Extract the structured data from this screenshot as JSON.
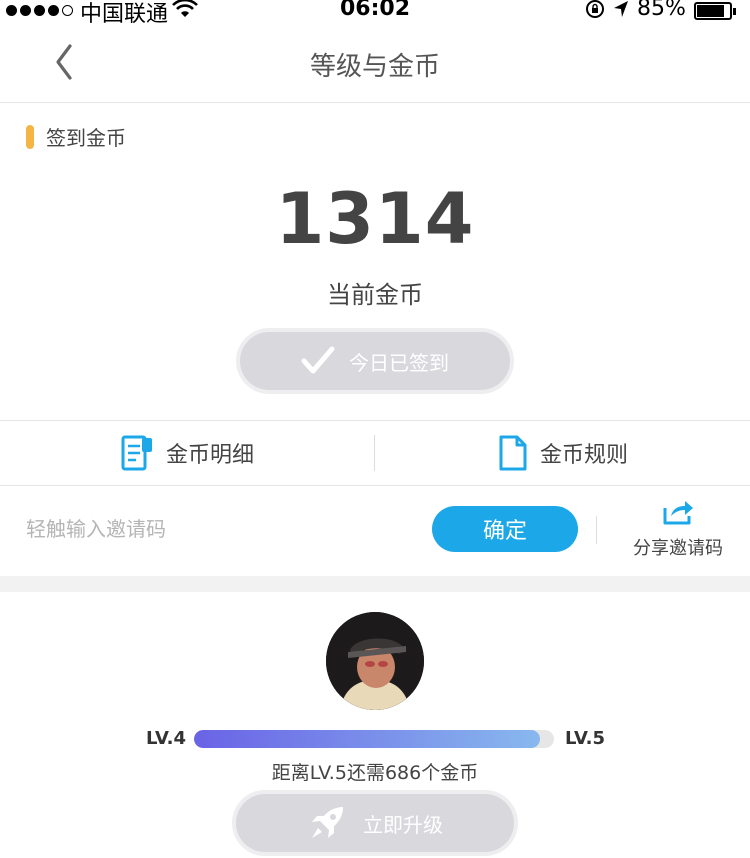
{
  "status_bar": {
    "carrier": "中国联通",
    "time": "06:02",
    "battery": "85%",
    "battery_level": 0.85
  },
  "nav": {
    "title": "等级与金币",
    "back_icon": "chevron-left-icon"
  },
  "coins": {
    "section_title": "签到金币",
    "amount": "1314",
    "label": "当前金币",
    "signed_button": "今日已签到",
    "accent_color": "#f5b545"
  },
  "links": {
    "detail": "金币明细",
    "rules": "金币规则",
    "icon_color": "#1ba7e8"
  },
  "invite": {
    "placeholder": "轻触输入邀请码",
    "confirm": "确定",
    "share": "分享邀请码"
  },
  "level": {
    "current": "LV.4",
    "next": "LV.5",
    "progress": 0.96,
    "hint": "距离LV.5还需686个金币",
    "upgrade_button": "立即升级"
  }
}
